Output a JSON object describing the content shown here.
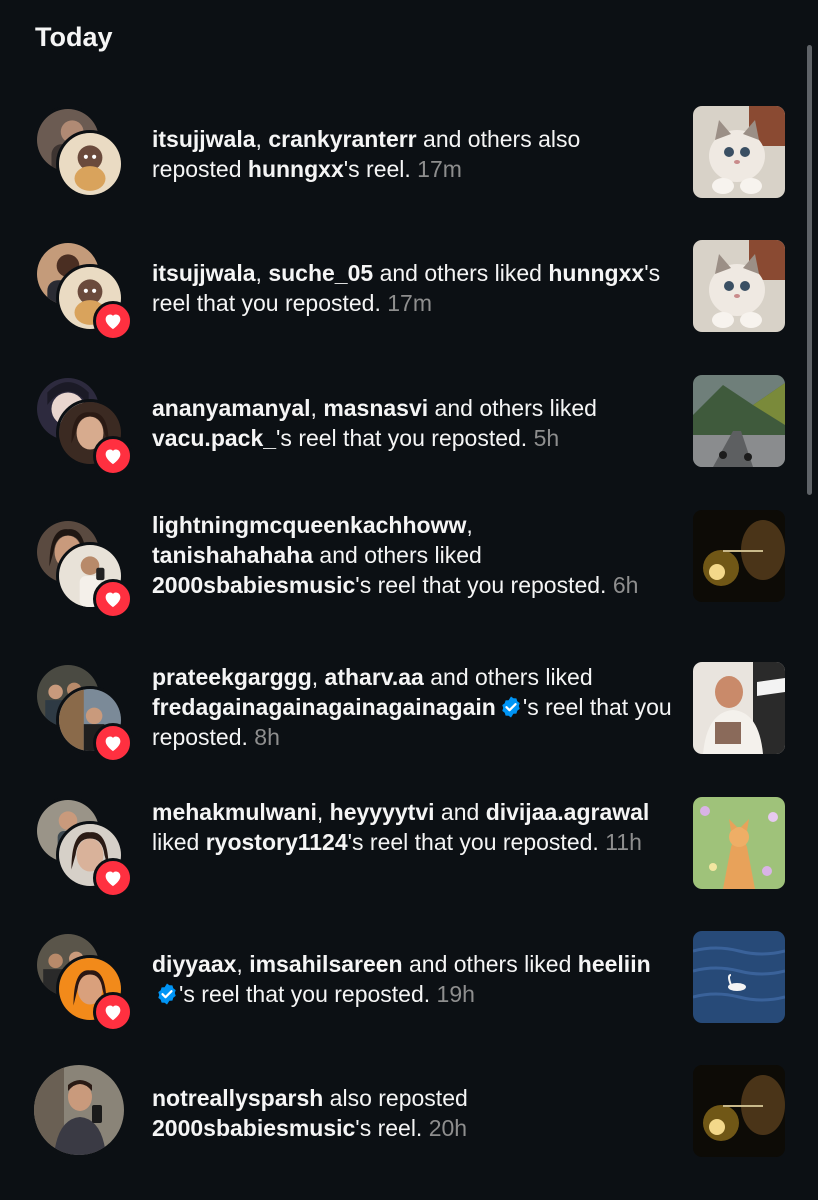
{
  "section": {
    "title": "Today"
  },
  "notifications": [
    {
      "user1": "itsujjwala",
      "sep": ", ",
      "user2": "crankyranterr",
      "mid": " and others also reposted ",
      "owner": "hunngxx",
      "tail": "'s reel.",
      "time": " 17m",
      "avatar_back_icon": "avatar-photo",
      "avatar_front_icon": "squirtle-avatar",
      "thumb_icon": "kitten-thumbnail"
    },
    {
      "user1": "itsujjwala",
      "sep": ", ",
      "user2": "suche_05",
      "mid": " and others liked ",
      "owner": "hunngxx",
      "tail": "'s reel that you reposted.",
      "time": " 17m",
      "avatar_back_icon": "avatar-photo",
      "avatar_front_icon": "squirtle-avatar",
      "thumb_icon": "kitten-thumbnail"
    },
    {
      "user1": "ananyamanyal",
      "sep": ", ",
      "user2": "masnasvi",
      "mid": " and others liked ",
      "owner": "vacu.pack_",
      "tail": "'s reel that you reposted.",
      "time": " 5h",
      "avatar_back_icon": "anime-avatar",
      "avatar_front_icon": "selfie-avatar",
      "thumb_icon": "mountain-road-thumbnail"
    },
    {
      "user1": "lightningmcqueenkachhoww",
      "sep": ", ",
      "user2": "tanishahahaha",
      "mid": " and others liked ",
      "owner": "2000sbabiesmusic",
      "tail": "'s reel that you reposted.",
      "time": "  6h",
      "avatar_back_icon": "selfie-avatar",
      "avatar_front_icon": "mirror-avatar",
      "thumb_icon": "music-video-thumbnail"
    },
    {
      "user1": "prateekgarggg",
      "sep": ", ",
      "user2": "atharv.aa",
      "mid": " and others liked ",
      "owner": "fredagainagainagainagainagain",
      "tail": "'s reel that you reposted.",
      "time": "  8h",
      "avatar_back_icon": "group-avatar",
      "avatar_front_icon": "street-avatar",
      "thumb_icon": "dj-thumbnail",
      "verified": true
    },
    {
      "user1": "mehakmulwani",
      "sep": ", ",
      "user2": "heyyyytvi",
      "mid": " and ",
      "user3": "divijaa.agrawal",
      "mid2": " liked ",
      "owner": "ryostory1124",
      "tail": "'s reel that you reposted.",
      "time": " 11h",
      "avatar_back_icon": "mirror-avatar",
      "avatar_front_icon": "selfie-avatar",
      "thumb_icon": "cat-in-flowers-thumbnail"
    },
    {
      "user1": "diyyaax",
      "sep": ", ",
      "user2": "imsahilsareen",
      "mid": " and others liked ",
      "owner": "heeliin",
      "tail": "'s reel that you reposted.",
      "time": " 19h",
      "avatar_back_icon": "group-avatar",
      "avatar_front_icon": "orange-avatar",
      "thumb_icon": "swan-lake-thumbnail",
      "verified": true
    },
    {
      "user1": "notreallysparsh",
      "mid": " also reposted ",
      "owner": "2000sbabiesmusic",
      "tail": "'s reel.",
      "time": " 20h",
      "avatar_single_icon": "mirror-selfie-avatar",
      "thumb_icon": "music-video-thumbnail"
    }
  ],
  "colors": {
    "background": "#0c1014",
    "text": "#f5f5f5",
    "muted": "#8e8e8e",
    "heart": "#ff3040",
    "verified": "#0095f6"
  }
}
